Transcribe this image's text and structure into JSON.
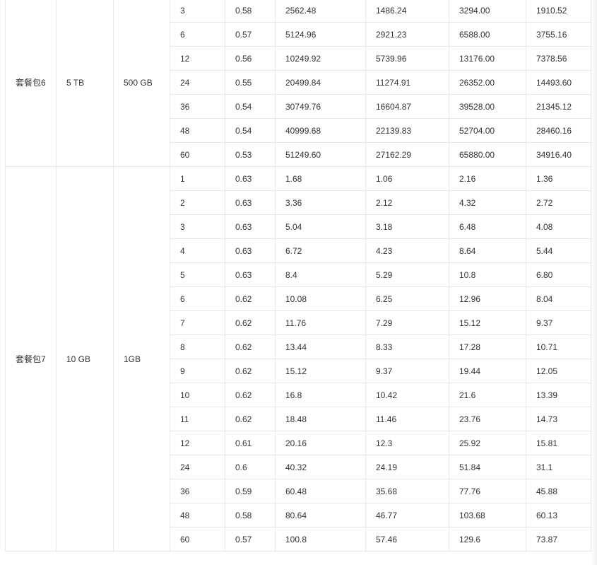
{
  "packages": [
    {
      "name": "套餐包6",
      "capacity": "5 TB",
      "traffic": "500 GB",
      "rows": [
        [
          "3",
          "0.58",
          "2562.48",
          "1486.24",
          "3294.00",
          "1910.52"
        ],
        [
          "6",
          "0.57",
          "5124.96",
          "2921.23",
          "6588.00",
          "3755.16"
        ],
        [
          "12",
          "0.56",
          "10249.92",
          "5739.96",
          "13176.00",
          "7378.56"
        ],
        [
          "24",
          "0.55",
          "20499.84",
          "11274.91",
          "26352.00",
          "14493.60"
        ],
        [
          "36",
          "0.54",
          "30749.76",
          "16604.87",
          "39528.00",
          "21345.12"
        ],
        [
          "48",
          "0.54",
          "40999.68",
          "22139.83",
          "52704.00",
          "28460.16"
        ],
        [
          "60",
          "0.53",
          "51249.60",
          "27162.29",
          "65880.00",
          "34916.40"
        ]
      ]
    },
    {
      "name": "套餐包7",
      "capacity": "10 GB",
      "traffic": "1GB",
      "rows": [
        [
          "1",
          "0.63",
          "1.68",
          "1.06",
          "2.16",
          "1.36"
        ],
        [
          "2",
          "0.63",
          "3.36",
          "2.12",
          "4.32",
          "2.72"
        ],
        [
          "3",
          "0.63",
          "5.04",
          "3.18",
          "6.48",
          "4.08"
        ],
        [
          "4",
          "0.63",
          "6.72",
          "4.23",
          "8.64",
          "5.44"
        ],
        [
          "5",
          "0.63",
          "8.4",
          "5.29",
          "10.8",
          "6.80"
        ],
        [
          "6",
          "0.62",
          "10.08",
          "6.25",
          "12.96",
          "8.04"
        ],
        [
          "7",
          "0.62",
          "11.76",
          "7.29",
          "15.12",
          "9.37"
        ],
        [
          "8",
          "0.62",
          "13.44",
          "8.33",
          "17.28",
          "10.71"
        ],
        [
          "9",
          "0.62",
          "15.12",
          "9.37",
          "19.44",
          "12.05"
        ],
        [
          "10",
          "0.62",
          "16.8",
          "10.42",
          "21.6",
          "13.39"
        ],
        [
          "11",
          "0.62",
          "18.48",
          "11.46",
          "23.76",
          "14.73"
        ],
        [
          "12",
          "0.61",
          "20.16",
          "12.3",
          "25.92",
          "15.81"
        ],
        [
          "24",
          "0.6",
          "40.32",
          "24.19",
          "51.84",
          "31.1"
        ],
        [
          "36",
          "0.59",
          "60.48",
          "35.68",
          "77.76",
          "45.88"
        ],
        [
          "48",
          "0.58",
          "80.64",
          "46.77",
          "103.68",
          "60.13"
        ],
        [
          "60",
          "0.57",
          "100.8",
          "57.46",
          "129.6",
          "73.87"
        ]
      ]
    }
  ]
}
